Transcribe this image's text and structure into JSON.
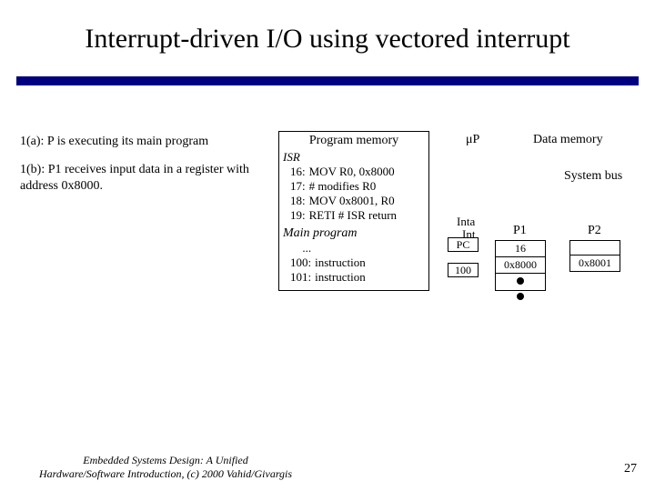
{
  "title": "Interrupt-driven I/O using vectored interrupt",
  "steps": {
    "a": "1(a): P is executing its main program",
    "b": "1(b): P1 receives input data in a register with address 0x8000."
  },
  "progmem": {
    "header": "Program memory",
    "isr_label": "ISR",
    "rows": [
      {
        "addr": "16:",
        "instr": "MOV R0, 0x8000"
      },
      {
        "addr": "17:",
        "instr": "# modifies R0"
      },
      {
        "addr": "18:",
        "instr": "MOV 0x8001, R0"
      },
      {
        "addr": "19:",
        "instr": "RETI  # ISR return"
      }
    ],
    "main_label": "Main program",
    "main_rows": [
      {
        "addr": "...",
        "instr": ""
      },
      {
        "addr": "100:",
        "instr": "instruction"
      },
      {
        "addr": "101:",
        "instr": "instruction"
      }
    ]
  },
  "labels": {
    "mup": "μP",
    "data_memory": "Data memory",
    "system_bus": "System bus",
    "inta": "Inta",
    "int": "Int",
    "p1": "P1",
    "p2": "P2",
    "pc": "PC",
    "pc_val": "100",
    "p1_top": "16",
    "p1_bot": "0x8000",
    "p2_val": "0x8001"
  },
  "footer": {
    "line1": "Embedded Systems Design: A Unified",
    "line2": "Hardware/Software Introduction, (c) 2000 Vahid/Givargis"
  },
  "page": "27"
}
